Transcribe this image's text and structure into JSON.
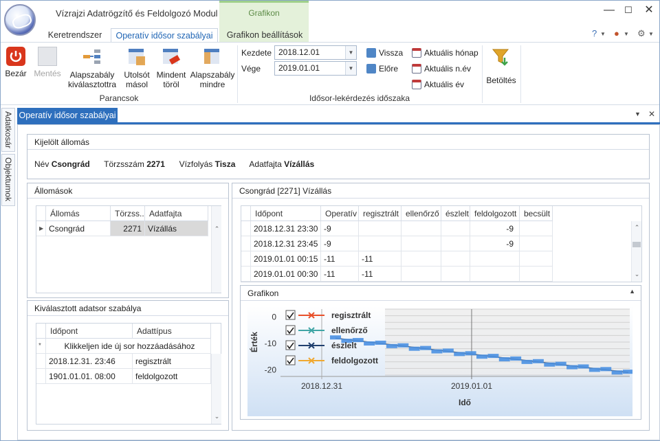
{
  "window": {
    "title": "Vízrajzi Adatrögzítő és Feldolgozó Modul",
    "context_tab": "Grafikon"
  },
  "tabs": [
    "Keretrendszer",
    "Operatív idősor szabályai",
    "Grafikon beállítások"
  ],
  "ribbon": {
    "close": "Bezár",
    "save": "Mentés",
    "rule_select": [
      "Alapszabály",
      "kiválasztottra"
    ],
    "copy_last": [
      "Utolsót",
      "másol"
    ],
    "delete_all": [
      "Mindent",
      "töröl"
    ],
    "rule_all": [
      "Alapszabály",
      "mindre"
    ],
    "group_commands": "Parancsok",
    "start_label": "Kezdete",
    "start_value": "2018.12.01",
    "end_label": "Vége",
    "end_value": "2019.01.01",
    "back": "Vissza",
    "forward": "Előre",
    "current_month": "Aktuális hónap",
    "current_quarter": "Aktuális n.év",
    "current_year": "Aktuális év",
    "group_period": "Idősor-lekérdezés időszaka",
    "load": "Betöltés"
  },
  "side_tabs": [
    "Adatkosár",
    "Objektumok"
  ],
  "doc_tab": "Operatív idősor szabályai",
  "selected_station": {
    "header": "Kijelölt állomás",
    "name_label": "Név",
    "name": "Csongrád",
    "reg_label": "Törzsszám",
    "reg": "2271",
    "river_label": "Vízfolyás",
    "river": "Tisza",
    "type_label": "Adatfajta",
    "type": "Vízállás"
  },
  "stations": {
    "header": "Állomások",
    "columns": [
      "Állomás",
      "Törzss...",
      "Adatfajta"
    ],
    "rows": [
      [
        "Csongrád",
        "2271",
        "Vízállás"
      ]
    ]
  },
  "rule": {
    "header": "Kiválasztott adatsor szabálya",
    "columns": [
      "Időpont",
      "Adattípus"
    ],
    "new_row": "Klikkeljen ide új sor hozzáadásához",
    "rows": [
      [
        "2018.12.31. 23:46",
        "regisztrált"
      ],
      [
        "1901.01.01. 08:00",
        "feldolgozott"
      ]
    ]
  },
  "series_panel": {
    "header": "Csongrád [2271] Vízállás",
    "columns": [
      "Időpont",
      "Operatív",
      "regisztrált",
      "ellenőrző",
      "észlelt",
      "feldolgozott",
      "becsült"
    ],
    "rows": [
      [
        "2018.12.31 23:30",
        "-9",
        "",
        "",
        "",
        "-9",
        ""
      ],
      [
        "2018.12.31 23:45",
        "-9",
        "",
        "",
        "",
        "-9",
        ""
      ],
      [
        "2019.01.01 00:15",
        "-11",
        "-11",
        "",
        "",
        "",
        ""
      ],
      [
        "2019.01.01 00:30",
        "-11",
        "-11",
        "",
        "",
        "",
        ""
      ]
    ]
  },
  "graph_panel": {
    "header": "Grafikon"
  },
  "chart_data": {
    "type": "line",
    "ylabel": "Érték",
    "xlabel": "Idő",
    "x_ticks": [
      "2018.12.31",
      "2019.01.01"
    ],
    "y_ticks": [
      0,
      -10,
      -20
    ],
    "ylim": [
      -22,
      3
    ],
    "legend_position": "top-left",
    "series": [
      {
        "name": "regisztrált",
        "color": "#e8502a",
        "checked": true
      },
      {
        "name": "ellenőrző",
        "color": "#3fa5a5",
        "checked": true
      },
      {
        "name": "észlelt",
        "color": "#1f3f6e",
        "checked": true
      },
      {
        "name": "feldolgozott",
        "color": "#f0a830",
        "checked": true
      }
    ],
    "trend": {
      "x_from": "2018.12.31",
      "x_to": "2019.01.01",
      "y_from": -8,
      "y_to": -21
    }
  }
}
